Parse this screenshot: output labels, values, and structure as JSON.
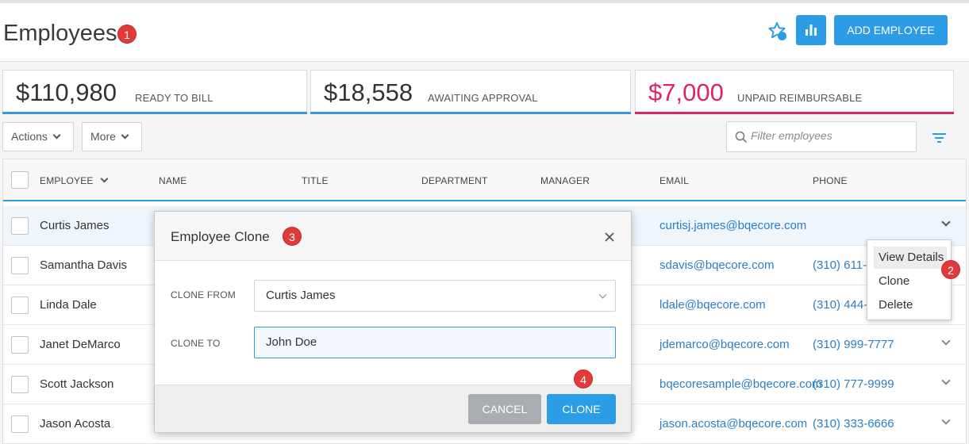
{
  "page": {
    "title": "Employees",
    "add_button": "ADD EMPLOYEE",
    "badges": [
      "1",
      "2",
      "3",
      "4"
    ]
  },
  "stats": [
    {
      "value": "$110,980",
      "label": "READY TO BILL",
      "accent": "#3399e0"
    },
    {
      "value": "$18,558",
      "label": "AWAITING APPROVAL",
      "accent": "#3399e0"
    },
    {
      "value": "$7,000",
      "label": "UNPAID REIMBURSABLE",
      "accent": "#e0245e"
    }
  ],
  "toolbar": {
    "actions_label": "Actions",
    "more_label": "More",
    "filter_placeholder": "Filter employees"
  },
  "table": {
    "columns": [
      "EMPLOYEE",
      "NAME",
      "TITLE",
      "DEPARTMENT",
      "MANAGER",
      "EMAIL",
      "PHONE"
    ],
    "rows": [
      {
        "employee": "Curtis James",
        "email": "curtisj.james@bqecore.com",
        "phone": ""
      },
      {
        "employee": "Samantha Davis",
        "email": "sdavis@bqecore.com",
        "phone": "(310) 611-"
      },
      {
        "employee": "Linda Dale",
        "email": "ldale@bqecore.com",
        "phone": "(310) 444-"
      },
      {
        "employee": "Janet DeMarco",
        "email": "jdemarco@bqecore.com",
        "phone": "(310) 999-7777"
      },
      {
        "employee": "Scott Jackson",
        "email": "bqecoresample@bqecore.com",
        "phone": "(310) 777-9999"
      },
      {
        "employee": "Jason Acosta",
        "email": "jason.acosta@bqecore.com",
        "phone": "(310) 333-6666"
      }
    ]
  },
  "row_menu": {
    "items": [
      "View Details",
      "Clone",
      "Delete"
    ]
  },
  "modal": {
    "title": "Employee Clone",
    "clone_from_label": "CLONE FROM",
    "clone_from_value": "Curtis James",
    "clone_to_label": "CLONE TO",
    "clone_to_value": "John Doe",
    "cancel_label": "CANCEL",
    "clone_label": "CLONE"
  },
  "colors": {
    "primary": "#2c9ce6",
    "badge": "#e03a3a",
    "link": "#2a7fc4",
    "unpaid": "#e0245e"
  }
}
